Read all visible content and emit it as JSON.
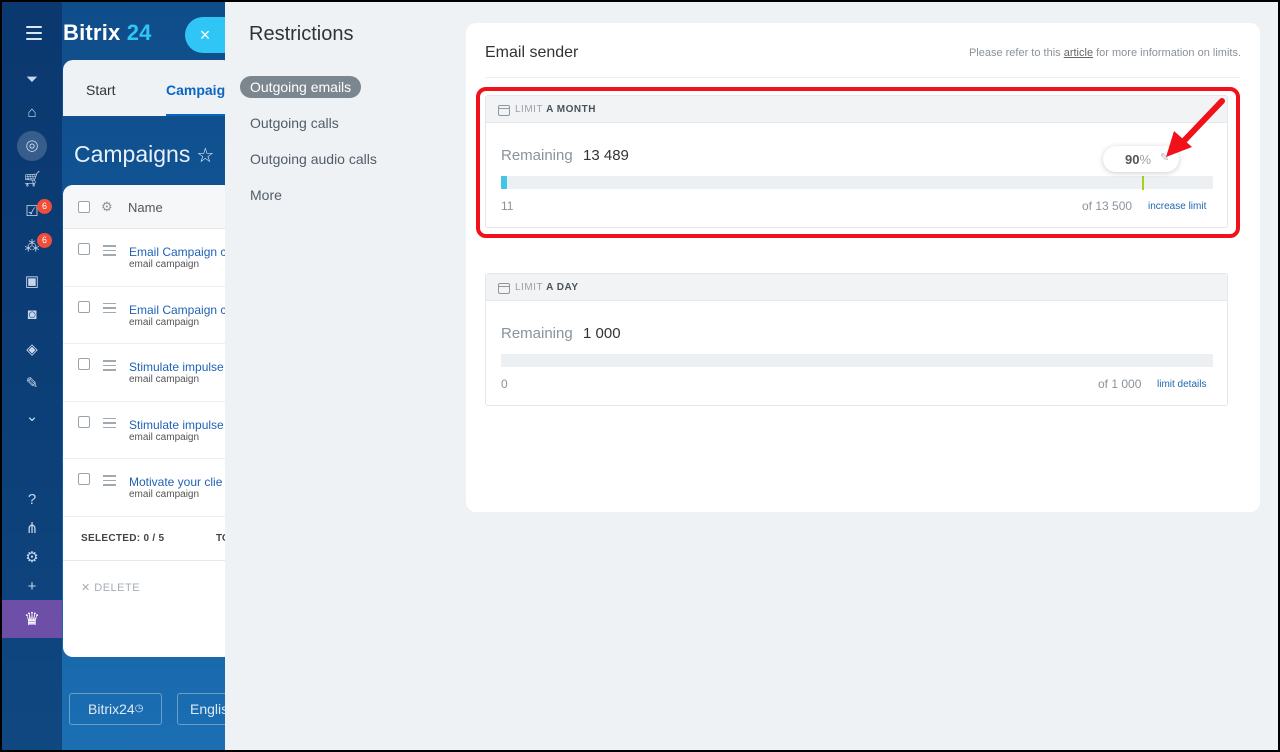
{
  "app": {
    "logo_text": "Bitrix",
    "logo_number": "24",
    "close_glyph": "×"
  },
  "left_rail": {
    "icons": [
      "menu-icon",
      "filter-icon",
      "home-icon",
      "target-icon",
      "cart-icon",
      "tasks-icon",
      "network-icon",
      "contacts-icon",
      "robot-icon",
      "box-icon",
      "sign-icon",
      "more-icon",
      "help-icon",
      "structure-icon",
      "settings-icon",
      "plus-icon",
      "crown-icon"
    ],
    "badges": [
      "6",
      "6"
    ]
  },
  "background": {
    "tabs": [
      "Start",
      "Campaign"
    ],
    "title": "Campaigns",
    "star": "☆",
    "list_header": "Name",
    "rows": [
      {
        "title": "Email Campaign c",
        "subtitle": "email campaign"
      },
      {
        "title": "Email Campaign c",
        "subtitle": "email campaign"
      },
      {
        "title": "Stimulate impulse",
        "subtitle": "email campaign"
      },
      {
        "title": "Stimulate impulse",
        "subtitle": "email campaign"
      },
      {
        "title": "Motivate your clie",
        "subtitle": "email campaign"
      }
    ],
    "selected": "SELECTED: 0 / 5",
    "total_trunc": "TO",
    "delete": "DELETE",
    "footer_brand": "Bitrix24",
    "footer_lang": "Englis"
  },
  "slider": {
    "title": "Restrictions",
    "menu": [
      "Outgoing emails",
      "Outgoing calls",
      "Outgoing audio calls",
      "More"
    ],
    "active_menu": "Outgoing emails"
  },
  "panel": {
    "title": "Email sender",
    "note_prefix": "Please refer to this ",
    "note_link": "article",
    "note_suffix": " for more information on limits.",
    "remaining_label": "Remaining",
    "limits": [
      {
        "label_prefix": "LIMIT",
        "label_period": "A MONTH",
        "remaining": "13 489",
        "used": "11",
        "of_total": "of 13 500",
        "link": "increase limit",
        "fill_fraction": 0.0008,
        "marker_percent": "90",
        "marker_unit": "%"
      },
      {
        "label_prefix": "LIMIT",
        "label_period": "A DAY",
        "remaining": "1 000",
        "used": "0",
        "of_total": "of 1 000",
        "link": "limit details",
        "fill_fraction": 0
      }
    ]
  },
  "colors": {
    "accent": "#2fc6f6",
    "bar_fill": "#43c5e8",
    "marker": "#a3d11c",
    "highlight": "#f1111b",
    "link": "#2067b0"
  }
}
